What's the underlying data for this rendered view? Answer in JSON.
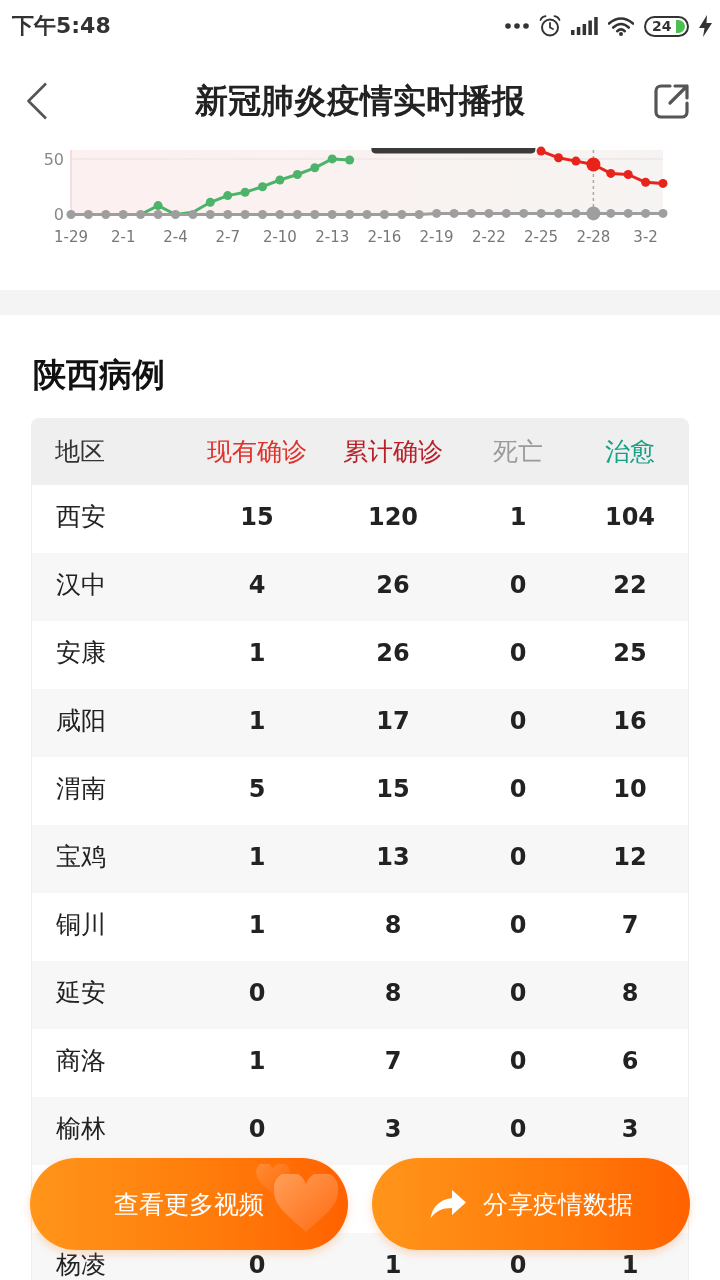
{
  "status_bar": {
    "time": "下午5:48",
    "battery": "24"
  },
  "header": {
    "title": "新冠肺炎疫情实时播报"
  },
  "chart": {
    "chart_data": {
      "type": "line",
      "categories": [
        "1-29",
        null,
        null,
        "2-1",
        null,
        null,
        "2-4",
        null,
        null,
        "2-7",
        null,
        null,
        "2-10",
        null,
        null,
        "2-13",
        null,
        null,
        "2-16",
        null,
        null,
        "2-19",
        null,
        null,
        "2-22",
        null,
        null,
        "2-25",
        null,
        null,
        "2-28",
        null,
        null,
        "3-2",
        null
      ],
      "series": [
        {
          "color": "#e8231b",
          "marker": "circle",
          "values": [
            null,
            null,
            null,
            null,
            null,
            null,
            null,
            null,
            null,
            null,
            null,
            null,
            null,
            null,
            null,
            null,
            null,
            null,
            null,
            null,
            null,
            null,
            null,
            null,
            null,
            null,
            null,
            57,
            51,
            48,
            45,
            37,
            36,
            29,
            28
          ]
        },
        {
          "color": "#4cb46a",
          "marker": "circle",
          "values": [
            null,
            null,
            null,
            null,
            0,
            8,
            0,
            2,
            11,
            17,
            20,
            25,
            31,
            36,
            42,
            50,
            49,
            null,
            null,
            null,
            null,
            null,
            null,
            null,
            null,
            null,
            null,
            null,
            null,
            null,
            null,
            null,
            null,
            null,
            null
          ]
        },
        {
          "color": "#9e9e9e",
          "marker": "circle",
          "values": [
            0,
            0,
            0,
            0,
            0,
            0,
            0,
            0,
            0,
            0,
            0,
            0,
            0,
            0,
            0,
            0,
            0,
            0,
            0,
            0,
            0,
            1,
            1,
            1,
            1,
            1,
            1,
            1,
            1,
            1,
            1,
            1,
            1,
            1,
            1
          ]
        }
      ],
      "ylim": [
        0,
        58
      ],
      "yticks": [
        0,
        50
      ],
      "ref_lines": [
        {
          "axis": "x",
          "value": "2-28"
        },
        {
          "axis": "y",
          "value": 50
        }
      ]
    }
  },
  "section": {
    "title": "陕西病例"
  },
  "table": {
    "columns": [
      {
        "label": "地区",
        "color": "#333333"
      },
      {
        "label": "现有确诊",
        "color": "#e0312a"
      },
      {
        "label": "累计确诊",
        "color": "#b8202a"
      },
      {
        "label": "死亡",
        "color": "#9b9b9b"
      },
      {
        "label": "治愈",
        "color": "#16a085"
      }
    ],
    "rows": [
      {
        "cells": [
          "西安",
          "15",
          "120",
          "1",
          "104"
        ]
      },
      {
        "cells": [
          "汉中",
          "4",
          "26",
          "0",
          "22"
        ]
      },
      {
        "cells": [
          "安康",
          "1",
          "26",
          "0",
          "25"
        ]
      },
      {
        "cells": [
          "咸阳",
          "1",
          "17",
          "0",
          "16"
        ]
      },
      {
        "cells": [
          "渭南",
          "5",
          "15",
          "0",
          "10"
        ]
      },
      {
        "cells": [
          "宝鸡",
          "1",
          "13",
          "0",
          "12"
        ]
      },
      {
        "cells": [
          "铜川",
          "1",
          "8",
          "0",
          "7"
        ]
      },
      {
        "cells": [
          "延安",
          "0",
          "8",
          "0",
          "8"
        ]
      },
      {
        "cells": [
          "商洛",
          "1",
          "7",
          "0",
          "6"
        ]
      },
      {
        "cells": [
          "榆林",
          "0",
          "3",
          "0",
          "3"
        ]
      }
    ],
    "rows_below_buttons": [
      {
        "cells": [
          "杨凌",
          "0",
          "1",
          "0",
          "1"
        ]
      }
    ]
  },
  "buttons": [
    {
      "label": "查看更多视频",
      "kind": "video"
    },
    {
      "label": "分享疫情数据",
      "kind": "share"
    }
  ]
}
